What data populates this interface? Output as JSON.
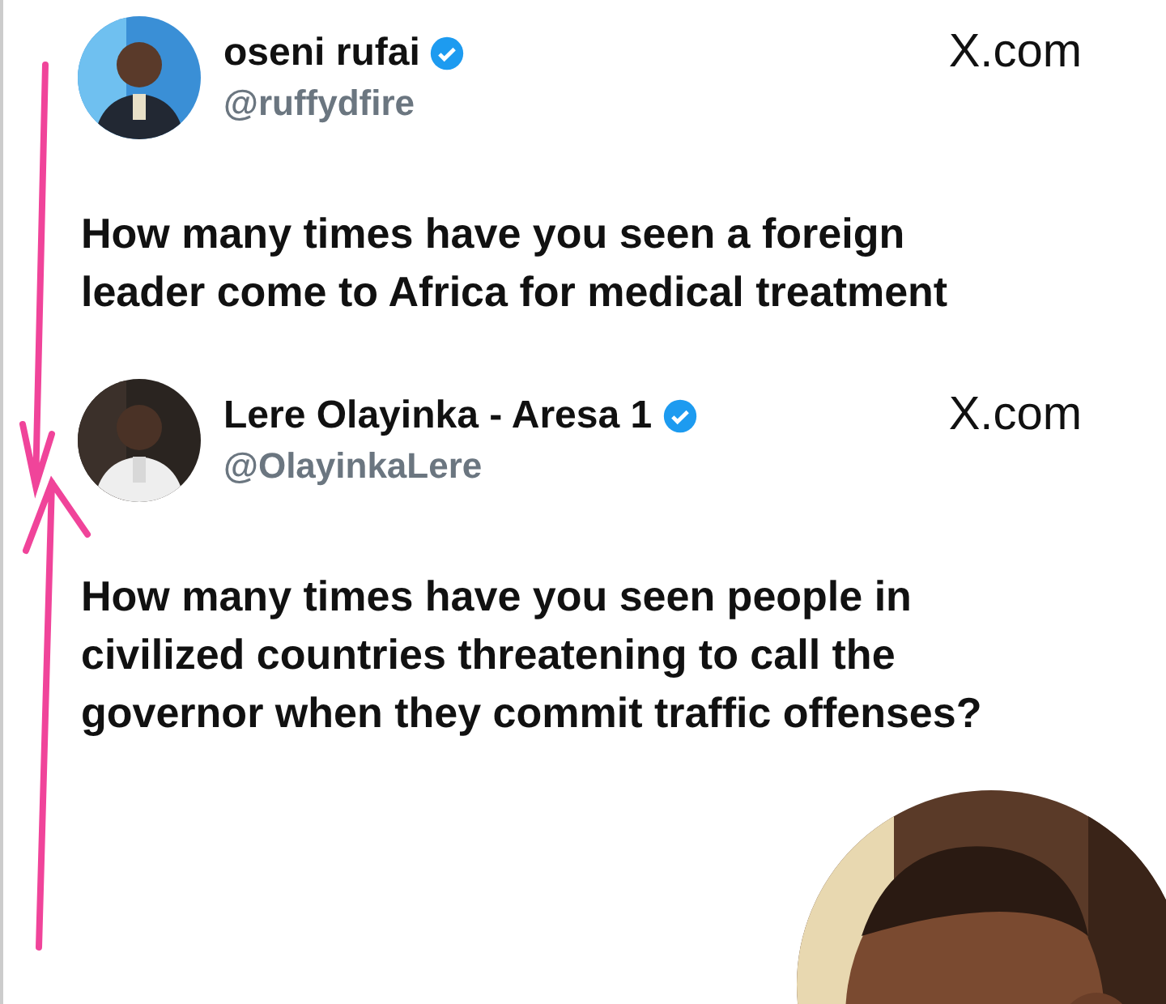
{
  "tweets": [
    {
      "name": "oseni rufai",
      "verified": true,
      "handle": "@ruffydfire",
      "source": "X.com",
      "text": "How many times have you seen a foreign leader come to Africa for medical treatment"
    },
    {
      "name": "Lere Olayinka - Aresa 1",
      "verified": true,
      "handle": "@OlayinkaLere",
      "source": "X.com",
      "text": "How many times have you seen people in civilized countries threatening to call the governor when they commit traffic offenses?"
    }
  ]
}
